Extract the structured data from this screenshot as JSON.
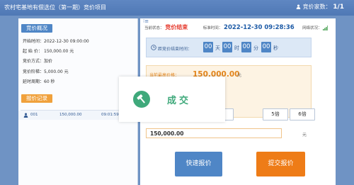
{
  "header": {
    "title": "农村宅基地有偿选位（第一期）竞价项目",
    "bid_count_label": "竞价家数：",
    "bid_count_value": "1/1"
  },
  "overview": {
    "section_title": "竞价概况",
    "rows": [
      {
        "label": "开始时间：",
        "value": "2022-12-30 09:00:00"
      },
      {
        "label": "起 始 价：",
        "value": "150,000.00 元"
      },
      {
        "label": "竞价方式：",
        "value": "加价"
      },
      {
        "label": "竞价阶梯：",
        "value": "5,000.00 元"
      },
      {
        "label": "延时周期：",
        "value": "60 秒"
      }
    ]
  },
  "bid_records": {
    "section_title": "报价记录",
    "rows": [
      {
        "bidder": "001",
        "amount": "150,000.00",
        "time": "09:01:59.153"
      }
    ]
  },
  "status": {
    "label": "当前状态：",
    "value": "竞价结束",
    "time_label": "标准时间：",
    "time_value": "2022-12-30 09:28:36",
    "network_label": "网络状况："
  },
  "countdown": {
    "label": "距竞价结束时间：",
    "days": "00",
    "days_unit": "天",
    "hours": "00",
    "hours_unit": "时",
    "minutes": "00",
    "minutes_unit": "分",
    "seconds": "00",
    "seconds_unit": "秒"
  },
  "highest": {
    "label": "当前最高价格：",
    "value": "150,000.00",
    "unit": "元"
  },
  "multipliers": [
    "4倍",
    "5倍",
    "6倍"
  ],
  "amount_input": {
    "value": "150,000.00",
    "unit": "元"
  },
  "buttons": {
    "quick": "快速报价",
    "submit": "提交报价"
  },
  "overlay": {
    "text": "成交"
  },
  "colors": {
    "header_blue": "#4f78b5",
    "accent_blue": "#4f86c6",
    "accent_orange": "#ee7c17",
    "status_red": "#e53a2d",
    "success_green": "#3fa97b"
  }
}
